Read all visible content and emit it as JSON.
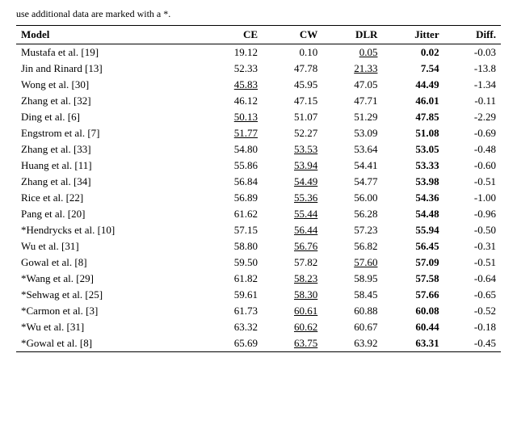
{
  "note": "use additional data are marked with a *.",
  "columns": [
    "Model",
    "CE",
    "CW",
    "DLR",
    "Jitter",
    "Diff."
  ],
  "rows": [
    {
      "model": "Mustafa et al. [19]",
      "ce": "19.12",
      "cw": "0.10",
      "dlr": "0.05",
      "dlr_underline": true,
      "jitter": "0.02",
      "jitter_bold": true,
      "diff": "-0.03"
    },
    {
      "model": "Jin and Rinard [13]",
      "ce": "52.33",
      "cw": "47.78",
      "dlr": "21.33",
      "dlr_underline": true,
      "jitter": "7.54",
      "jitter_bold": true,
      "diff": "-13.8"
    },
    {
      "model": "Wong et al. [30]",
      "ce": "45.83",
      "ce_underline": true,
      "cw": "45.95",
      "dlr": "47.05",
      "jitter": "44.49",
      "jitter_bold": true,
      "diff": "-1.34"
    },
    {
      "model": "Zhang et al. [32]",
      "ce": "46.12",
      "cw": "47.15",
      "dlr": "47.71",
      "jitter": "46.01",
      "jitter_bold": true,
      "diff": "-0.11"
    },
    {
      "model": "Ding et al. [6]",
      "ce": "50.13",
      "ce_underline": true,
      "cw": "51.07",
      "dlr": "51.29",
      "jitter": "47.85",
      "jitter_bold": true,
      "diff": "-2.29"
    },
    {
      "model": "Engstrom et al. [7]",
      "ce": "51.77",
      "ce_underline": true,
      "cw": "52.27",
      "dlr": "53.09",
      "jitter": "51.08",
      "jitter_bold": true,
      "diff": "-0.69"
    },
    {
      "model": "Zhang et al. [33]",
      "ce": "54.80",
      "cw": "53.53",
      "cw_underline": true,
      "dlr": "53.64",
      "jitter": "53.05",
      "jitter_bold": true,
      "diff": "-0.48"
    },
    {
      "model": "Huang et al. [11]",
      "ce": "55.86",
      "cw": "53.94",
      "cw_underline": true,
      "dlr": "54.41",
      "jitter": "53.33",
      "jitter_bold": true,
      "diff": "-0.60"
    },
    {
      "model": "Zhang et al. [34]",
      "ce": "56.84",
      "cw": "54.49",
      "cw_underline": true,
      "dlr": "54.77",
      "jitter": "53.98",
      "jitter_bold": true,
      "diff": "-0.51"
    },
    {
      "model": "Rice et al. [22]",
      "ce": "56.89",
      "cw": "55.36",
      "cw_underline": true,
      "dlr": "56.00",
      "jitter": "54.36",
      "jitter_bold": true,
      "diff": "-1.00"
    },
    {
      "model": "Pang et al. [20]",
      "ce": "61.62",
      "cw": "55.44",
      "cw_underline": true,
      "dlr": "56.28",
      "jitter": "54.48",
      "jitter_bold": true,
      "diff": "-0.96"
    },
    {
      "model": "*Hendrycks et al. [10]",
      "ce": "57.15",
      "cw": "56.44",
      "cw_underline": true,
      "dlr": "57.23",
      "jitter": "55.94",
      "jitter_bold": true,
      "diff": "-0.50"
    },
    {
      "model": "Wu et al. [31]",
      "ce": "58.80",
      "cw": "56.76",
      "cw_underline": true,
      "dlr": "56.82",
      "jitter": "56.45",
      "jitter_bold": true,
      "diff": "-0.31"
    },
    {
      "model": "Gowal et al. [8]",
      "ce": "59.50",
      "cw": "57.82",
      "dlr": "57.60",
      "dlr_underline": true,
      "jitter": "57.09",
      "jitter_bold": true,
      "diff": "-0.51"
    },
    {
      "model": "*Wang et al. [29]",
      "ce": "61.82",
      "cw": "58.23",
      "cw_underline": true,
      "dlr": "58.95",
      "jitter": "57.58",
      "jitter_bold": true,
      "diff": "-0.64"
    },
    {
      "model": "*Sehwag et al. [25]",
      "ce": "59.61",
      "cw": "58.30",
      "cw_underline": true,
      "dlr": "58.45",
      "jitter": "57.66",
      "jitter_bold": true,
      "diff": "-0.65"
    },
    {
      "model": "*Carmon et al. [3]",
      "ce": "61.73",
      "cw": "60.61",
      "cw_underline": true,
      "dlr": "60.88",
      "jitter": "60.08",
      "jitter_bold": true,
      "diff": "-0.52"
    },
    {
      "model": "*Wu et al. [31]",
      "ce": "63.32",
      "cw": "60.62",
      "cw_underline": true,
      "dlr": "60.67",
      "jitter": "60.44",
      "jitter_bold": true,
      "diff": "-0.18"
    },
    {
      "model": "*Gowal et al. [8]",
      "ce": "65.69",
      "cw": "63.75",
      "cw_underline": true,
      "dlr": "63.92",
      "jitter": "63.31",
      "jitter_bold": true,
      "diff": "-0.45"
    }
  ]
}
